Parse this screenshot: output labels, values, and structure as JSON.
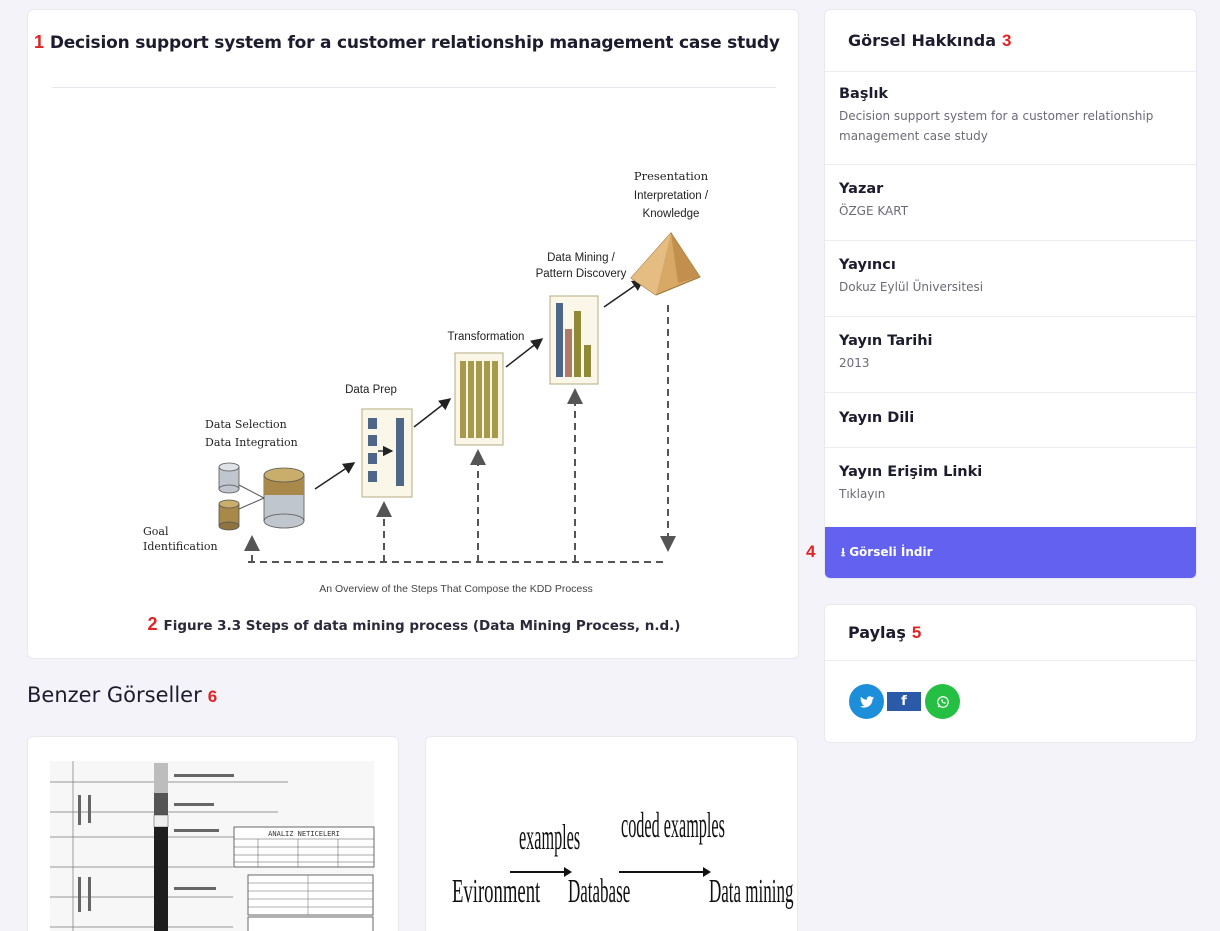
{
  "main": {
    "title_marker": "1",
    "title": "Decision support system for a customer relationship management case study",
    "caption_marker": "2",
    "caption": "Figure 3.3 Steps of data mining process (Data Mining Process, n.d.)",
    "figure": {
      "labels": {
        "goal": [
          "Goal",
          "Identification"
        ],
        "selection": [
          "Data Selection",
          "Data Integration"
        ],
        "prep": "Data Prep",
        "transformation": "Transformation",
        "mining": [
          "Data Mining /",
          "Pattern Discovery"
        ],
        "presentation": [
          "Presentation",
          "Interpretation /",
          "Knowledge"
        ],
        "footer": "An Overview of the Steps That Compose the KDD Process"
      },
      "colors": {
        "cylinder_top": "#b8bfc7",
        "cylinder_gold": "#a8894a",
        "transform_fill": "#a89a4a",
        "bar_blue": "#4e6788",
        "bar_red": "#b07a6a",
        "bar_olive": "#8e8a36",
        "pyramid": "#d8a866"
      }
    }
  },
  "similar": {
    "heading": "Benzer Görseller",
    "marker": "6",
    "thumb2_labels": [
      "Evironment",
      "examples",
      "Database",
      "coded examples",
      "Data mining"
    ],
    "thumb1_labels": [
      "ANALIZ NETICELERI"
    ]
  },
  "info": {
    "header": "Görsel Hakkında",
    "marker": "3",
    "rows": [
      {
        "label": "Başlık",
        "value": "Decision support system for a customer relationship management case study"
      },
      {
        "label": "Yazar",
        "value": "ÖZGE KART"
      },
      {
        "label": "Yayıncı",
        "value": "Dokuz Eylül Üniversitesi"
      },
      {
        "label": "Yayın Tarihi",
        "value": "2013"
      },
      {
        "label": "Yayın Dili",
        "value": ""
      },
      {
        "label": "Yayın Erişim Linki",
        "value": "Tıklayın"
      }
    ],
    "download_label": "Görseli İndir",
    "download_icon": "download-icon",
    "download_marker": "4",
    "accent_color": "#6261f0"
  },
  "share": {
    "header": "Paylaş",
    "marker": "5",
    "buttons": [
      {
        "name": "twitter",
        "icon": "twitter-icon",
        "color": "#1d8ed9"
      },
      {
        "name": "facebook",
        "icon": "facebook-icon",
        "glyph": "f",
        "color": "#2b5aa8"
      },
      {
        "name": "whatsapp",
        "icon": "whatsapp-icon",
        "color": "#25c043"
      }
    ]
  }
}
